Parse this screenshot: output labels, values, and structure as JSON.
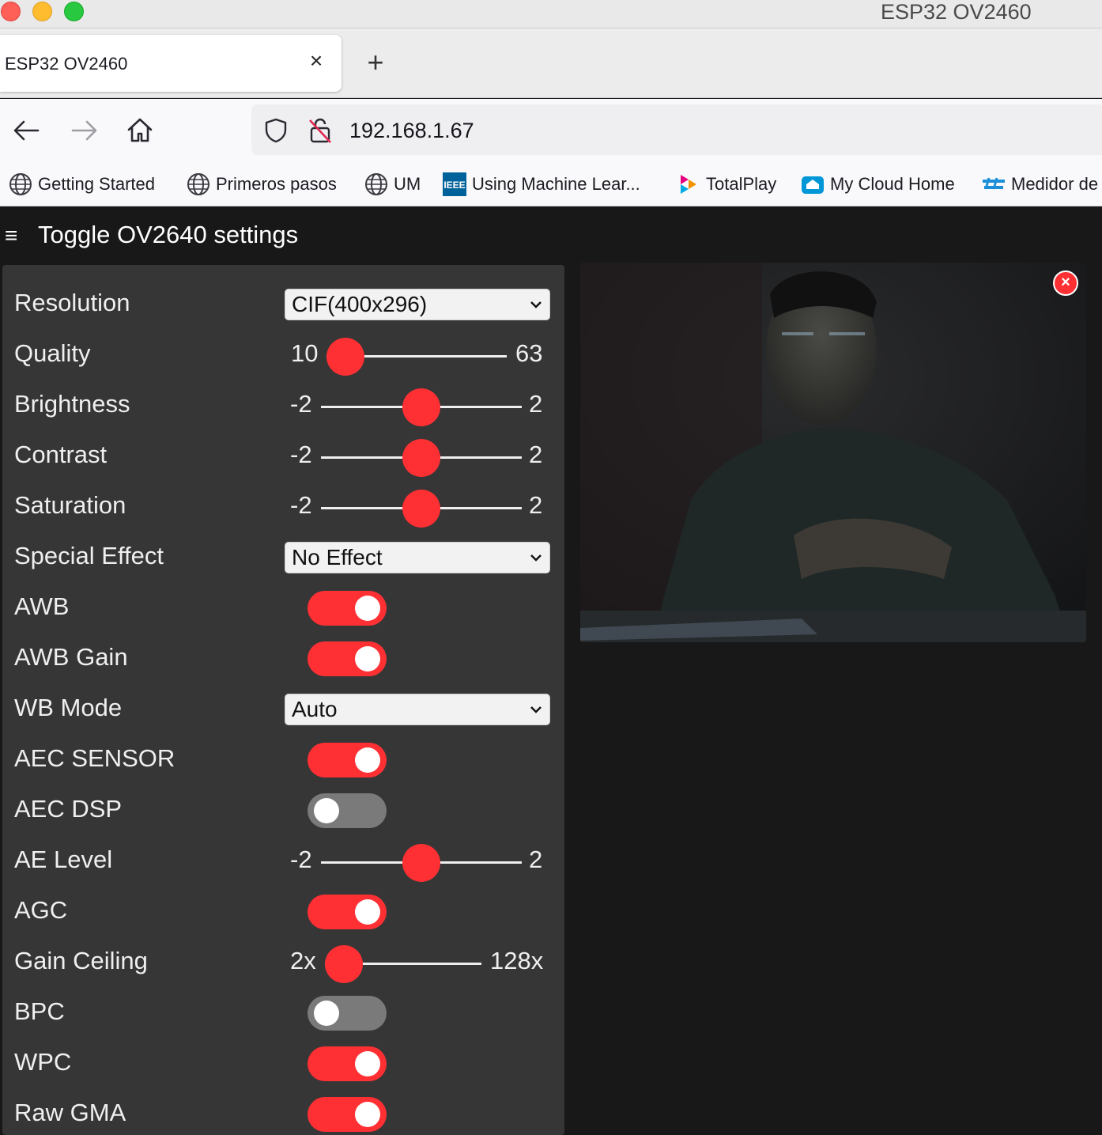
{
  "window": {
    "title": "ESP32 OV2460"
  },
  "tab": {
    "label": "ESP32 OV2460",
    "close": "×",
    "new": "+"
  },
  "url": "192.168.1.67",
  "bookmarks": [
    {
      "label": "Getting Started",
      "icon": "globe-icon"
    },
    {
      "label": "Primeros pasos",
      "icon": "globe-icon"
    },
    {
      "label": "UM",
      "icon": "globe-icon"
    },
    {
      "label": "Using Machine Lear...",
      "icon": "ieee-icon"
    },
    {
      "label": "TotalPlay",
      "icon": "totalplay-icon"
    },
    {
      "label": "My Cloud Home",
      "icon": "cloud-icon"
    },
    {
      "label": "Medidor de",
      "icon": "speed-icon"
    }
  ],
  "menu": {
    "icon": "≡",
    "title": "Toggle OV2640 settings"
  },
  "settings": {
    "resolution": {
      "label": "Resolution",
      "value": "CIF(400x296)"
    },
    "quality": {
      "label": "Quality",
      "min": "10",
      "max": "63",
      "value": 10
    },
    "brightness": {
      "label": "Brightness",
      "min": "-2",
      "max": "2",
      "value": 0
    },
    "contrast": {
      "label": "Contrast",
      "min": "-2",
      "max": "2",
      "value": 0
    },
    "saturation": {
      "label": "Saturation",
      "min": "-2",
      "max": "2",
      "value": 0
    },
    "special_effect": {
      "label": "Special Effect",
      "value": "No Effect"
    },
    "awb": {
      "label": "AWB",
      "on": true
    },
    "awb_gain": {
      "label": "AWB Gain",
      "on": true
    },
    "wb_mode": {
      "label": "WB Mode",
      "value": "Auto"
    },
    "aec_sensor": {
      "label": "AEC SENSOR",
      "on": true
    },
    "aec_dsp": {
      "label": "AEC DSP",
      "on": false
    },
    "ae_level": {
      "label": "AE Level",
      "min": "-2",
      "max": "2",
      "value": 0
    },
    "agc": {
      "label": "AGC",
      "on": true
    },
    "gain_ceiling": {
      "label": "Gain Ceiling",
      "min": "2x",
      "max": "128x",
      "value": 0
    },
    "bpc": {
      "label": "BPC",
      "on": false
    },
    "wpc": {
      "label": "WPC",
      "on": true
    },
    "raw_gma": {
      "label": "Raw GMA",
      "on": true
    }
  },
  "stream": {
    "close": "×"
  },
  "colors": {
    "accent": "#ff3034",
    "panel": "#363636",
    "background": "#181818"
  }
}
